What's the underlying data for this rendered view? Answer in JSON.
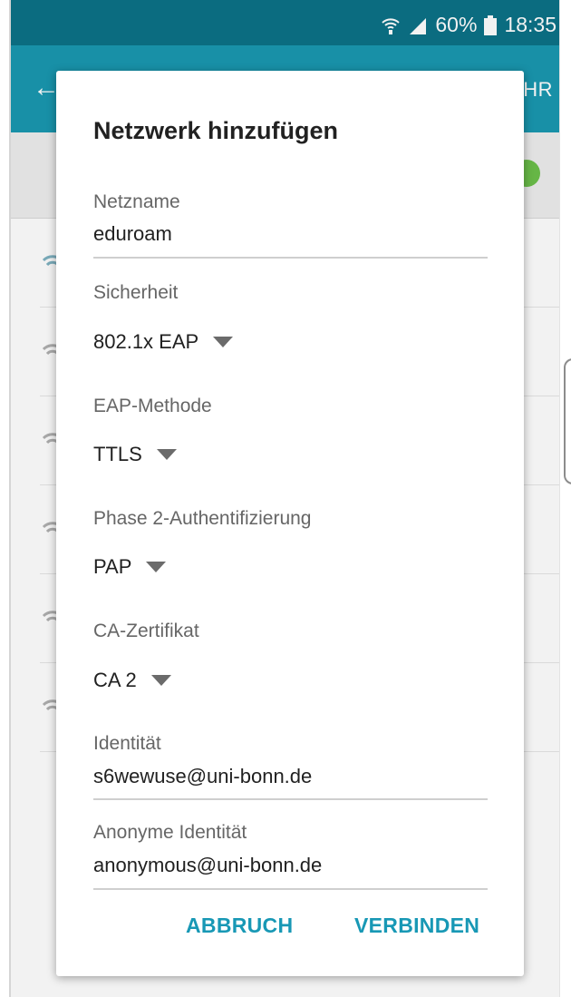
{
  "statusbar": {
    "battery": "60%",
    "time": "18:35",
    "icons": [
      "wifi-calling-icon",
      "signal-icon",
      "battery-icon"
    ]
  },
  "appbar": {
    "back_icon": "back-arrow-icon",
    "action_label_partial": "HR"
  },
  "dialog": {
    "title": "Netzwerk hinzufügen",
    "netzname": {
      "label": "Netzname",
      "value": "eduroam"
    },
    "sicherheit": {
      "label": "Sicherheit",
      "value": "802.1x EAP"
    },
    "eap_methode": {
      "label": "EAP-Methode",
      "value": "TTLS"
    },
    "phase2": {
      "label": "Phase 2-Authentifizierung",
      "value": "PAP"
    },
    "ca_zertifikat": {
      "label": "CA-Zertifikat",
      "value": "CA 2"
    },
    "identitaet": {
      "label": "Identität",
      "value": "s6wewuse@uni-bonn.de"
    },
    "anonyme_identitaet": {
      "label": "Anonyme Identität",
      "value": "anonymous@uni-bonn.de"
    },
    "buttons": {
      "cancel": "ABBRUCH",
      "connect": "VERBINDEN"
    }
  },
  "colors": {
    "statusbar": "#0c7287",
    "appbar": "#1a98b0",
    "accent": "#1898b5",
    "toggle_on": "#6cc04a"
  }
}
